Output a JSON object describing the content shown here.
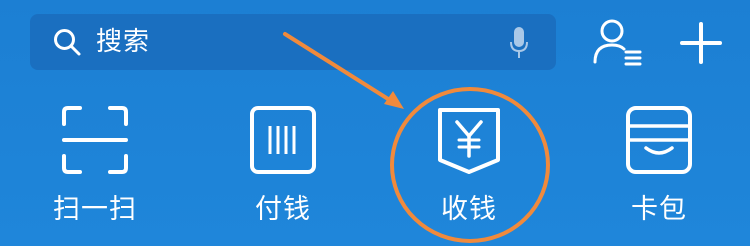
{
  "search": {
    "placeholder": "搜索"
  },
  "grid": {
    "items": [
      {
        "label": "扫一扫",
        "icon": "scan-icon"
      },
      {
        "label": "付钱",
        "icon": "pay-code-icon"
      },
      {
        "label": "收钱",
        "icon": "receive-money-icon"
      },
      {
        "label": "卡包",
        "icon": "card-wallet-icon"
      }
    ]
  },
  "colors": {
    "background": "#1e82d6",
    "search_bar": "#1a6fc0",
    "icon": "#ffffff",
    "annotation": "#f08a3c"
  }
}
